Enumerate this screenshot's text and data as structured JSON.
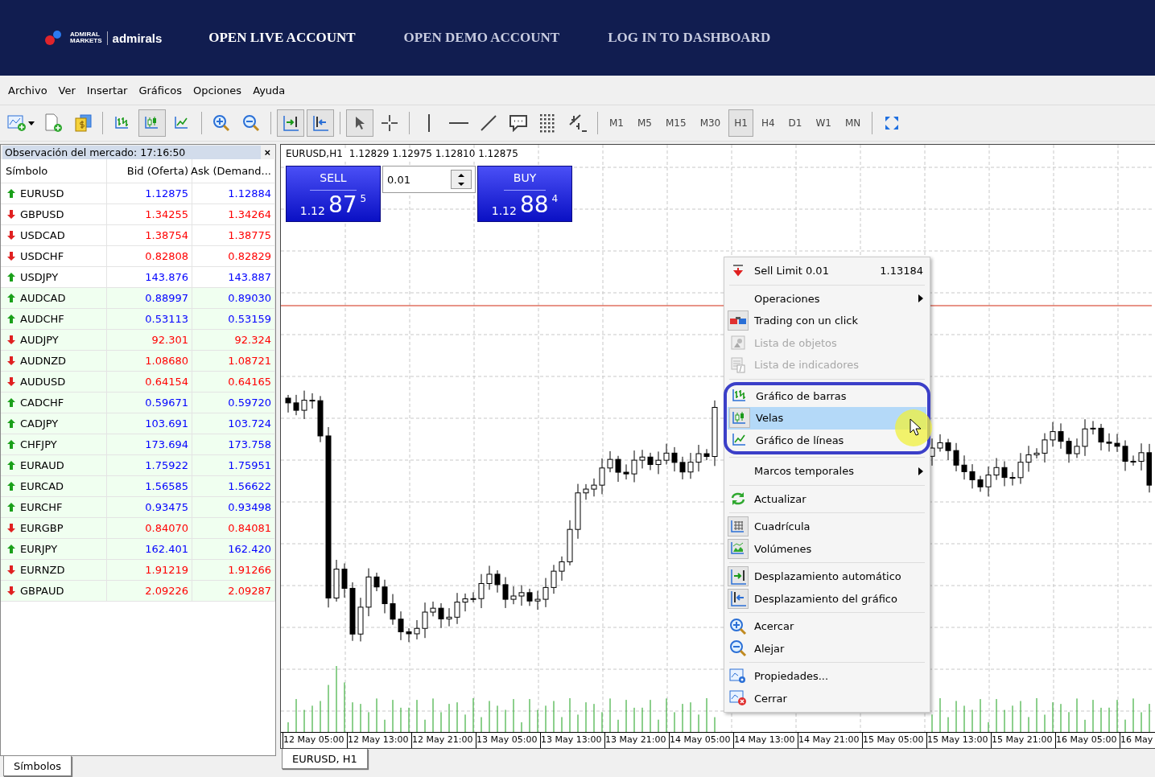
{
  "header": {
    "logo": {
      "line_1": "ADMIRAL",
      "line_2": "MARKETS",
      "brand": "admirals"
    },
    "nav": [
      {
        "label": "OPEN LIVE ACCOUNT",
        "selected": true
      },
      {
        "label": "OPEN DEMO ACCOUNT",
        "selected": false
      },
      {
        "label": "LOG IN TO DASHBOARD",
        "selected": false
      }
    ]
  },
  "menu_bar": [
    "Archivo",
    "Ver",
    "Insertar",
    "Gráficos",
    "Opciones",
    "Ayuda"
  ],
  "toolbar": {
    "tools": [
      {
        "kind": "tool",
        "pressed": false
      },
      {
        "kind": "tool",
        "pressed": false
      },
      {
        "kind": "tool",
        "pressed": false
      },
      {
        "kind": "separator"
      },
      {
        "kind": "tool",
        "pressed": false
      },
      {
        "kind": "tool",
        "pressed": true
      },
      {
        "kind": "tool",
        "pressed": false
      },
      {
        "kind": "separator"
      },
      {
        "kind": "tool",
        "pressed": false
      },
      {
        "kind": "tool",
        "pressed": false
      },
      {
        "kind": "separator"
      },
      {
        "kind": "tool",
        "pressed": true
      },
      {
        "kind": "tool",
        "pressed": true
      },
      {
        "kind": "separator"
      },
      {
        "kind": "tool",
        "pressed": true
      },
      {
        "kind": "tool",
        "pressed": false
      },
      {
        "kind": "separator"
      },
      {
        "kind": "tool",
        "pressed": false
      },
      {
        "kind": "tool",
        "pressed": false
      },
      {
        "kind": "tool",
        "pressed": false
      },
      {
        "kind": "tool",
        "pressed": false
      },
      {
        "kind": "tool",
        "pressed": false
      },
      {
        "kind": "tool",
        "pressed": false
      }
    ],
    "timeframes": [
      {
        "label": "M1",
        "selected": false
      },
      {
        "label": "M5",
        "selected": false
      },
      {
        "label": "M15",
        "selected": false
      },
      {
        "label": "M30",
        "selected": false
      },
      {
        "label": "H1",
        "selected": true
      },
      {
        "label": "H4",
        "selected": false
      },
      {
        "label": "D1",
        "selected": false
      },
      {
        "label": "W1",
        "selected": false
      },
      {
        "label": "MN",
        "selected": false
      }
    ]
  },
  "market_watch": {
    "title": "Observación del mercado: 17:16:50",
    "close": "×",
    "columns": [
      "Símbolo",
      "Bid (Oferta)",
      "Ask (Demand..."
    ],
    "rows": [
      {
        "symbol": "EURUSD",
        "bid": "1.12875",
        "ask": "1.12884",
        "rising": true,
        "shaded": false
      },
      {
        "symbol": "GBPUSD",
        "bid": "1.34255",
        "ask": "1.34264",
        "rising": false,
        "shaded": false
      },
      {
        "symbol": "USDCAD",
        "bid": "1.38754",
        "ask": "1.38775",
        "rising": false,
        "shaded": false
      },
      {
        "symbol": "USDCHF",
        "bid": "0.82808",
        "ask": "0.82829",
        "rising": false,
        "shaded": false
      },
      {
        "symbol": "USDJPY",
        "bid": "143.876",
        "ask": "143.887",
        "rising": true,
        "shaded": false
      },
      {
        "symbol": "AUDCAD",
        "bid": "0.88997",
        "ask": "0.89030",
        "rising": true,
        "shaded": true
      },
      {
        "symbol": "AUDCHF",
        "bid": "0.53113",
        "ask": "0.53159",
        "rising": true,
        "shaded": true
      },
      {
        "symbol": "AUDJPY",
        "bid": "92.301",
        "ask": "92.324",
        "rising": false,
        "shaded": true
      },
      {
        "symbol": "AUDNZD",
        "bid": "1.08680",
        "ask": "1.08721",
        "rising": false,
        "shaded": true
      },
      {
        "symbol": "AUDUSD",
        "bid": "0.64154",
        "ask": "0.64165",
        "rising": false,
        "shaded": true
      },
      {
        "symbol": "CADCHF",
        "bid": "0.59671",
        "ask": "0.59720",
        "rising": true,
        "shaded": true
      },
      {
        "symbol": "CADJPY",
        "bid": "103.691",
        "ask": "103.724",
        "rising": true,
        "shaded": true
      },
      {
        "symbol": "CHFJPY",
        "bid": "173.694",
        "ask": "173.758",
        "rising": true,
        "shaded": true
      },
      {
        "symbol": "EURAUD",
        "bid": "1.75922",
        "ask": "1.75951",
        "rising": true,
        "shaded": true
      },
      {
        "symbol": "EURCAD",
        "bid": "1.56585",
        "ask": "1.56622",
        "rising": true,
        "shaded": true
      },
      {
        "symbol": "EURCHF",
        "bid": "0.93475",
        "ask": "0.93498",
        "rising": true,
        "shaded": true
      },
      {
        "symbol": "EURGBP",
        "bid": "0.84070",
        "ask": "0.84081",
        "rising": false,
        "shaded": true
      },
      {
        "symbol": "EURJPY",
        "bid": "162.401",
        "ask": "162.420",
        "rising": true,
        "shaded": true
      },
      {
        "symbol": "EURNZD",
        "bid": "1.91219",
        "ask": "1.91266",
        "rising": false,
        "shaded": true
      },
      {
        "symbol": "GBPAUD",
        "bid": "2.09226",
        "ask": "2.09287",
        "rising": false,
        "shaded": true
      }
    ],
    "tab": "Símbolos"
  },
  "chart": {
    "title": "EURUSD,H1",
    "ohlc": "1.12829 1.12975 1.12810 1.12875",
    "trade_panel": {
      "sell": {
        "label": "SELL",
        "price_big": "1.12",
        "price_main": "87",
        "price_small": "5"
      },
      "lot": "0.01",
      "buy": {
        "label": "BUY",
        "price_big": "1.12",
        "price_main": "88",
        "price_small": "4"
      }
    },
    "time_axis": [
      "12 May 05:00",
      "12 May 13:00",
      "12 May 21:00",
      "13 May 05:00",
      "13 May 13:00",
      "13 May 21:00",
      "14 May 05:00",
      "14 May 13:00",
      "14 May 21:00",
      "15 May 05:00",
      "15 May 13:00",
      "15 May 21:00",
      "16 May 05:00",
      "16 May"
    ],
    "tab": "EURUSD, H1"
  },
  "context_menu": [
    {
      "kind": "item",
      "label": "Sell Limit 0.01",
      "value": "1.13184",
      "submenu": false,
      "disabled": false,
      "checked": false,
      "selected": false,
      "outlined": false
    },
    {
      "kind": "separator"
    },
    {
      "kind": "item",
      "label": "Operaciones",
      "submenu": true,
      "disabled": false,
      "checked": false,
      "selected": false,
      "outlined": false
    },
    {
      "kind": "item",
      "label": "Trading con un click",
      "submenu": false,
      "disabled": false,
      "checked": true,
      "selected": false,
      "outlined": false
    },
    {
      "kind": "item",
      "label": "Lista de objetos",
      "submenu": false,
      "disabled": true,
      "checked": false,
      "selected": false,
      "outlined": false
    },
    {
      "kind": "item",
      "label": "Lista de indicadores",
      "submenu": false,
      "disabled": true,
      "checked": false,
      "selected": false,
      "outlined": false
    },
    {
      "kind": "separator"
    },
    {
      "kind": "item",
      "label": "Gráfico de barras",
      "submenu": false,
      "disabled": false,
      "checked": false,
      "selected": false,
      "outlined": true
    },
    {
      "kind": "item",
      "label": "Velas",
      "submenu": false,
      "disabled": false,
      "checked": true,
      "selected": true,
      "outlined": true
    },
    {
      "kind": "item",
      "label": "Gráfico de líneas",
      "submenu": false,
      "disabled": false,
      "checked": false,
      "selected": false,
      "outlined": true
    },
    {
      "kind": "separator"
    },
    {
      "kind": "item",
      "label": "Marcos temporales",
      "submenu": true,
      "disabled": false,
      "checked": false,
      "selected": false,
      "outlined": false
    },
    {
      "kind": "separator"
    },
    {
      "kind": "item",
      "label": "Actualizar",
      "submenu": false,
      "disabled": false,
      "checked": false,
      "selected": false,
      "outlined": false
    },
    {
      "kind": "separator"
    },
    {
      "kind": "item",
      "label": "Cuadrícula",
      "submenu": false,
      "disabled": false,
      "checked": true,
      "selected": false,
      "outlined": false
    },
    {
      "kind": "item",
      "label": "Volúmenes",
      "submenu": false,
      "disabled": false,
      "checked": true,
      "selected": false,
      "outlined": false
    },
    {
      "kind": "separator"
    },
    {
      "kind": "item",
      "label": "Desplazamiento automático",
      "submenu": false,
      "disabled": false,
      "checked": true,
      "selected": false,
      "outlined": false
    },
    {
      "kind": "item",
      "label": "Desplazamiento del gráfico",
      "submenu": false,
      "disabled": false,
      "checked": true,
      "selected": false,
      "outlined": false
    },
    {
      "kind": "separator"
    },
    {
      "kind": "item",
      "label": "Acercar",
      "submenu": false,
      "disabled": false,
      "checked": false,
      "selected": false,
      "outlined": false
    },
    {
      "kind": "item",
      "label": "Alejar",
      "submenu": false,
      "disabled": false,
      "checked": false,
      "selected": false,
      "outlined": false
    },
    {
      "kind": "separator"
    },
    {
      "kind": "item",
      "label": "Propiedades...",
      "submenu": false,
      "disabled": false,
      "checked": false,
      "selected": false,
      "outlined": false
    },
    {
      "kind": "item",
      "label": "Cerrar",
      "submenu": false,
      "disabled": false,
      "checked": false,
      "selected": false,
      "outlined": false
    }
  ]
}
